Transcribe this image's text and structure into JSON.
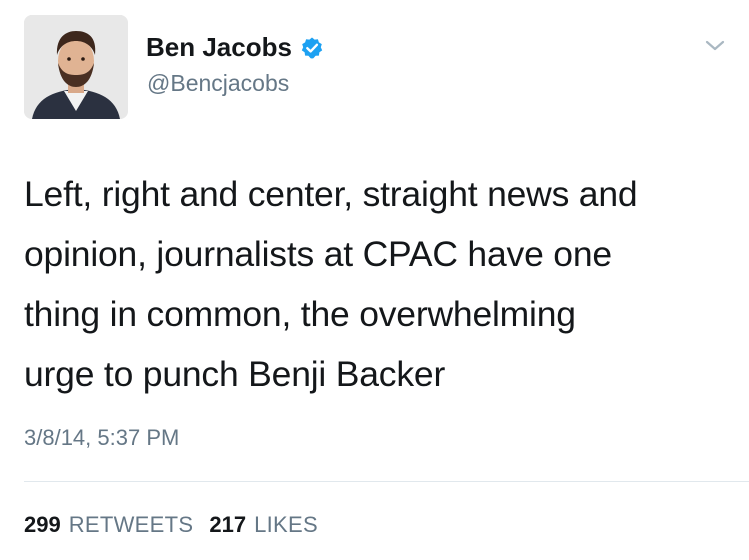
{
  "user": {
    "display_name": "Ben Jacobs",
    "handle": "@Bencjacobs",
    "verified": true
  },
  "tweet": {
    "lines": [
      "Left, right and center, straight news and",
      "opinion, journalists at CPAC have one",
      "thing in common, the overwhelming",
      "urge to punch Benji Backer"
    ],
    "timestamp": "3/8/14, 5:37 PM"
  },
  "stats": {
    "retweets_count": "299",
    "retweets_label": "RETWEETS",
    "likes_count": "217",
    "likes_label": "LIKES"
  },
  "icons": {
    "verified": "verified-badge-icon",
    "menu": "chevron-down-icon"
  },
  "colors": {
    "verified_blue": "#1da1f2",
    "secondary_text": "#657786",
    "primary_text": "#14171a"
  }
}
